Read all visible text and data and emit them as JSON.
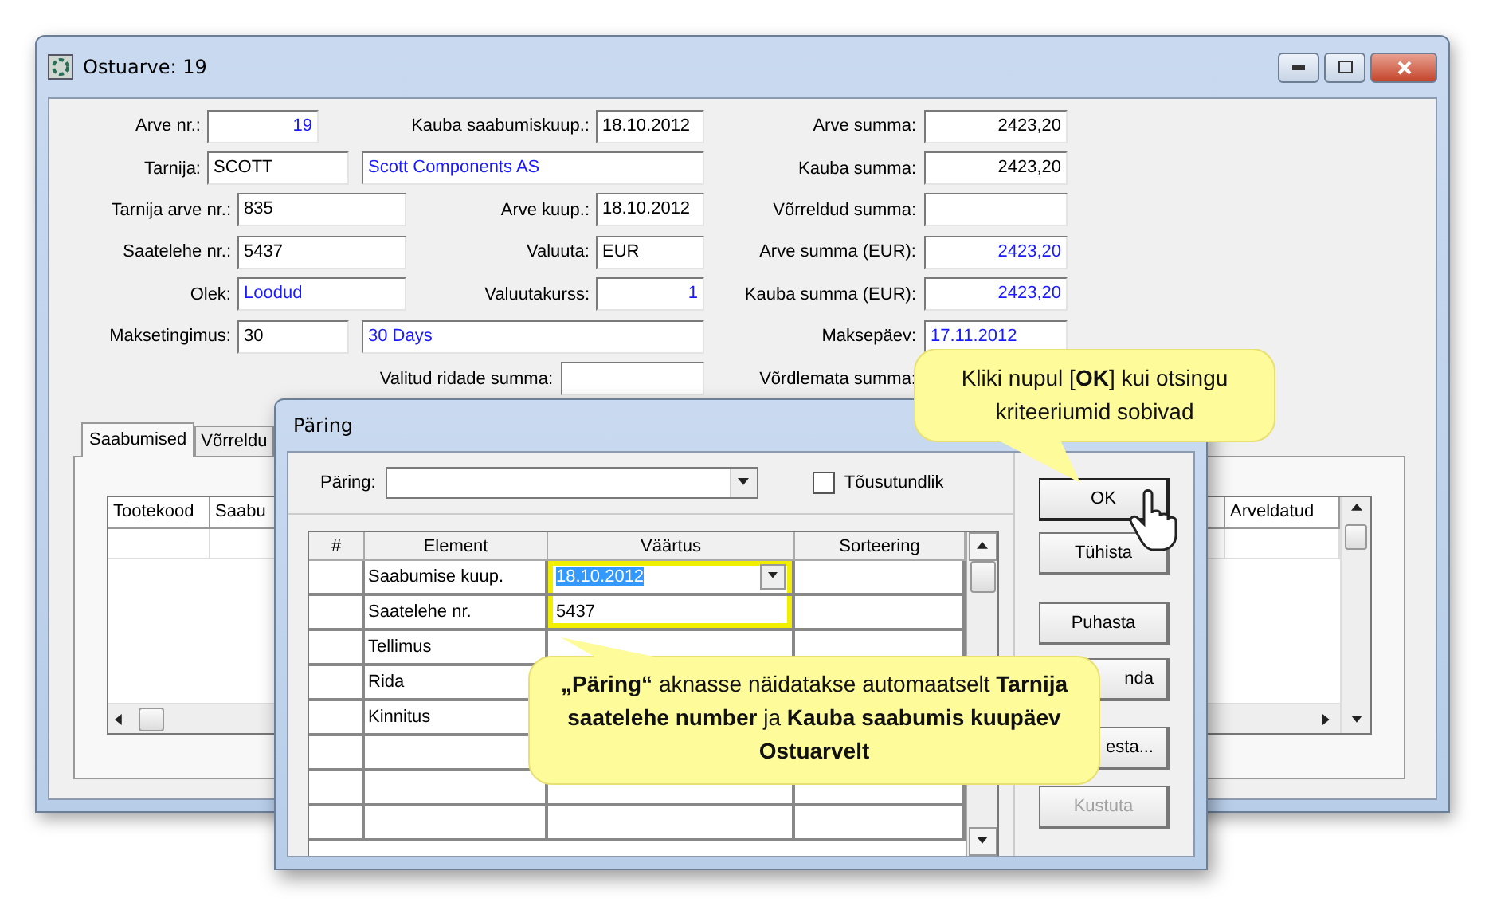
{
  "main_window": {
    "title": "Ostuarve: 19",
    "form_rows": [
      [
        {
          "label": "Arve nr.:",
          "value": "19",
          "readonly": true,
          "numeric": true
        },
        {
          "label": "Kauba saabumiskuup.:",
          "value": "18.10.2012",
          "readonly": false,
          "numeric": false
        },
        {
          "label": "Arve summa:",
          "value": "2423,20",
          "readonly": false,
          "numeric": true
        }
      ],
      [
        {
          "label": "Tarnija:",
          "value": "SCOTT",
          "readonly": false,
          "numeric": false
        },
        {
          "value": "Scott Components AS",
          "readonly": true,
          "numeric": false
        },
        {
          "label": "Kauba summa:",
          "value": "2423,20",
          "readonly": false,
          "numeric": true
        }
      ],
      [
        {
          "label": "Tarnija arve nr.:",
          "value": "835",
          "readonly": false,
          "numeric": false
        },
        {
          "label": "Arve kuup.:",
          "value": "18.10.2012",
          "readonly": false,
          "numeric": false
        },
        {
          "label": "Võrreldud summa:"
        }
      ],
      [
        {
          "label": "Saatelehe nr.:",
          "value": "5437",
          "readonly": false,
          "numeric": false
        },
        {
          "label": "Valuuta:",
          "value": "EUR",
          "readonly": false,
          "numeric": false
        },
        {
          "label": "Arve summa (EUR):",
          "value": "2423,20",
          "readonly": true,
          "numeric": true
        }
      ],
      [
        {
          "label": "Olek:",
          "value": "Loodud",
          "readonly": true,
          "numeric": false
        },
        {
          "label": "Valuutakurss:",
          "value": "1",
          "readonly": true,
          "numeric": true
        },
        {
          "label": "Kauba summa (EUR):",
          "value": "2423,20",
          "readonly": true,
          "numeric": true
        }
      ],
      [
        {
          "label": "Maksetingimus:",
          "value": "30",
          "readonly": false,
          "numeric": false
        },
        {
          "value": "30 Days",
          "readonly": true,
          "numeric": false
        },
        {
          "label": "Maksepäev:",
          "value": "17.11.2012",
          "readonly": true,
          "numeric": false
        }
      ],
      [
        {
          "label": "Valitud ridade summa:"
        },
        {
          "label": "Võrdlemata summa:"
        }
      ]
    ],
    "tabs": [
      {
        "label": "Saabumised",
        "selected": true
      },
      {
        "label": "Võrreldu",
        "selected": false
      }
    ],
    "grid_columns": [
      "Tootekood",
      "Saabu",
      "Arveldatud"
    ]
  },
  "query_dialog": {
    "title": "Päring",
    "query_label": "Päring:",
    "case_sensitive": {
      "label": "Tõusutundlik",
      "checked": false
    },
    "columns": [
      "#",
      "Element",
      "Väärtus",
      "Sorteering"
    ],
    "rows": [
      {
        "element": "Saabumise kuup.",
        "value": "18.10.2012",
        "kind": "combo",
        "highlighted": true
      },
      {
        "element": "Saatelehe nr.",
        "value": "5437",
        "kind": "text",
        "highlighted": true
      },
      {
        "element": "Tellimus",
        "kind": "text",
        "highlighted": false
      },
      {
        "element": "Rida",
        "kind": "text"
      },
      {
        "element": "Kinnitus",
        "kind": "text"
      }
    ],
    "buttons": [
      {
        "label": "OK",
        "disabled": false
      },
      {
        "label": "Tühista",
        "disabled": false
      },
      {
        "label": "Puhasta",
        "disabled": false
      },
      {
        "label": "nda",
        "disabled": false
      },
      {
        "label": "esta...",
        "disabled": false
      },
      {
        "label": "Kustuta",
        "disabled": true
      }
    ]
  },
  "callouts": [
    {
      "text": "Kliki nupul [**OK**] kui otsingu kriteeriumid sobivad"
    },
    {
      "text": "**„Päring“** aknasse näidatakse automaatselt **Tarnija saatelehe number** ja **Kauba saabumis kuupäev Ostuarvelt**"
    }
  ]
}
